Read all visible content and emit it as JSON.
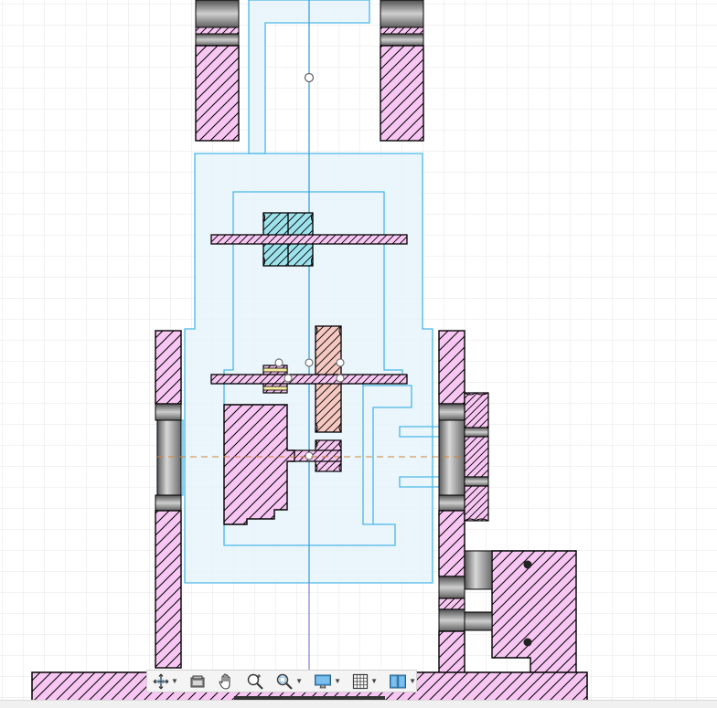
{
  "app": {
    "view": "section-view",
    "accent": "#3aa8dc"
  },
  "colors": {
    "hatch_fill": "#f7c6f2",
    "gear_fill": "#f6c8c2",
    "cyan_fill": "#9ee2ec",
    "sketch_fill": "#e6f4fc",
    "sketch_line": "#49b6e6",
    "grid": "#e2e2e2",
    "centerline": "#d2843a"
  },
  "toolbar": {
    "items": [
      {
        "id": "orbit",
        "icon": "orbit-icon",
        "dropdown": true
      },
      {
        "id": "look-at",
        "icon": "look-at-icon",
        "dropdown": false
      },
      {
        "id": "pan",
        "icon": "pan-hand-icon",
        "dropdown": false
      },
      {
        "id": "zoom",
        "icon": "zoom-icon",
        "dropdown": false
      },
      {
        "id": "zoom-window",
        "icon": "zoom-window-icon",
        "dropdown": true
      },
      {
        "id": "display-settings",
        "icon": "display-monitor-icon",
        "dropdown": true
      },
      {
        "id": "grid-snaps",
        "icon": "grid-icon",
        "dropdown": true
      },
      {
        "id": "viewports",
        "icon": "viewports-icon",
        "dropdown": true
      }
    ]
  }
}
